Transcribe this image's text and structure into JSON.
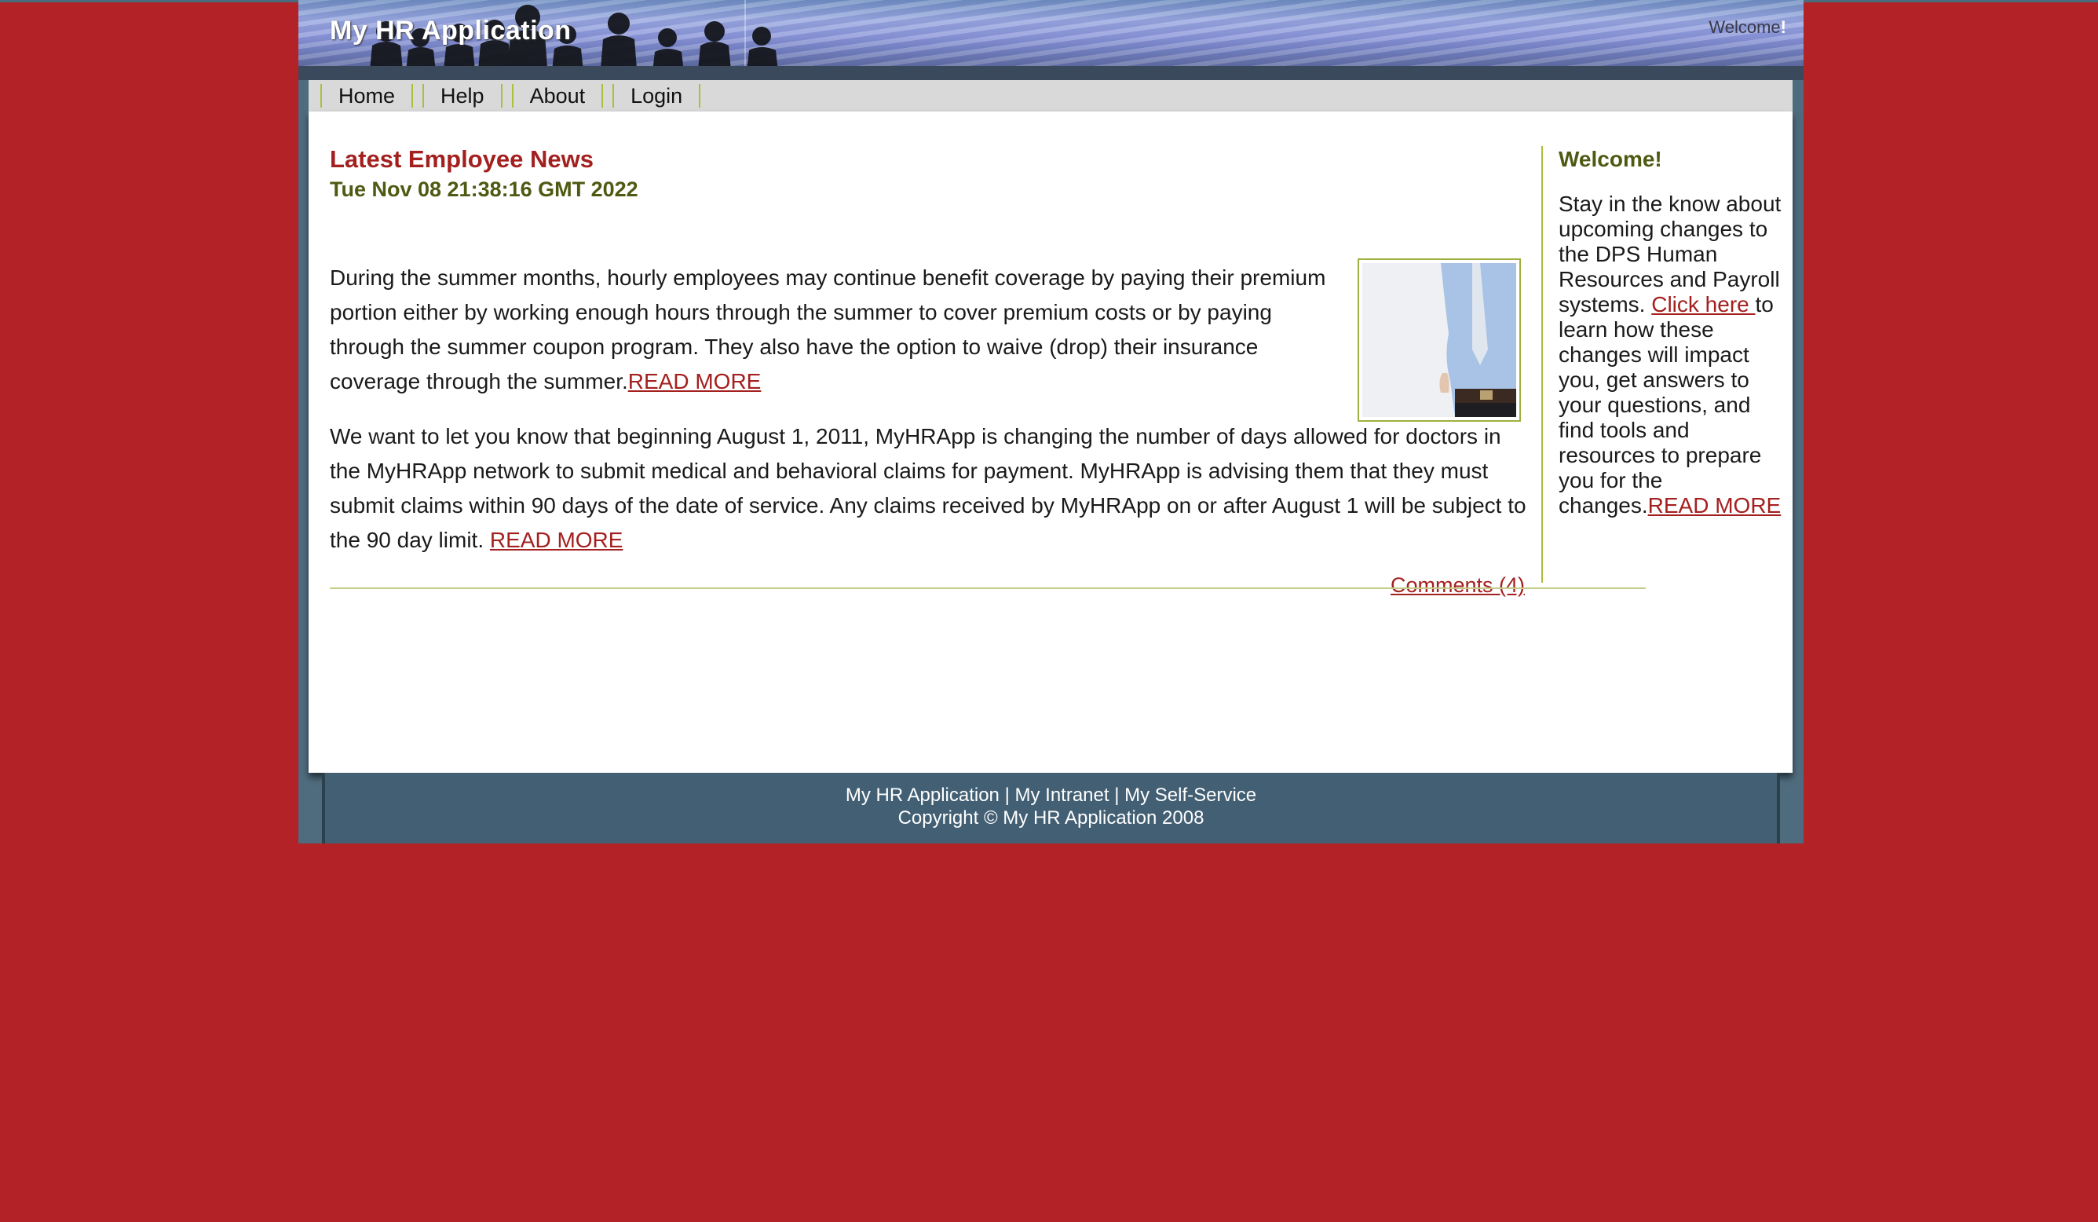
{
  "header": {
    "app_title": "My HR Application",
    "welcome_text": "Welcome",
    "welcome_bang": "!"
  },
  "nav": {
    "items": [
      {
        "label": "Home"
      },
      {
        "label": "Help"
      },
      {
        "label": "About"
      },
      {
        "label": "Login"
      }
    ]
  },
  "main": {
    "news_title": "Latest Employee News",
    "news_date": "Tue Nov 08 21:38:16 GMT 2022",
    "paragraph1": "During the summer months, hourly employees may continue benefit coverage by paying their premium portion either by working enough hours through the summer to cover premium costs or by paying through the summer coupon program. They also have the option to waive (drop) their insurance coverage through the summer.",
    "paragraph1_link": "READ MORE",
    "paragraph2": "We want to let you know that beginning August 1, 2011, MyHRApp is changing the number of days allowed for doctors in the MyHRApp network to submit medical and behavioral claims for payment.  MyHRApp is advising them that they must submit claims within 90 days of the date of service.  Any claims received by MyHRApp on or after August 1 will be subject to the 90 day limit. ",
    "paragraph2_link": "READ MORE",
    "comments_link": "Comments (4)"
  },
  "sidebar": {
    "title": "Welcome!",
    "text_before_link": "Stay in the know about upcoming changes to the DPS Human Resources and Payroll systems. ",
    "click_here_link": "Click here ",
    "text_after_link": "to learn how these changes will impact you, get answers to your questions, and find tools and resources to prepare you for the changes.",
    "read_more_link": "READ MORE"
  },
  "footer": {
    "link1": "My HR Application",
    "sep": " | ",
    "link2": "My Intranet",
    "link3": "My Self-Service",
    "copyright": "Copyright © My HR Application 2008"
  },
  "colors": {
    "background": "#b22226",
    "link": "#a3201f",
    "heading_green": "#4e5a12",
    "accent_green": "#a8c03a",
    "footer": "#425f73"
  }
}
